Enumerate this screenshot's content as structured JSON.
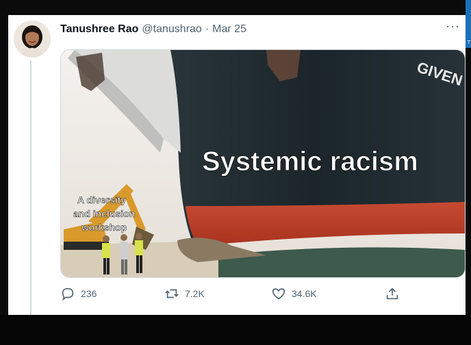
{
  "tweet": {
    "name": "Tanushree Rao",
    "handle": "@tanushrao",
    "separator": "·",
    "date": "Mar 25",
    "more": "···"
  },
  "media": {
    "caption_ship": "Systemic racism",
    "caption_excavator": "A diversity and inclusion workshop",
    "hull_lettering": "GIVEN"
  },
  "actions": {
    "replies": "236",
    "retweets": "7.2K",
    "likes": "34.6K"
  },
  "colors": {
    "hull_dark": "#1f2a2f",
    "hull_red": "#c8432c",
    "water": "#3d5a4c",
    "sand": "#d8cdb9",
    "excavator": "#d99a2b",
    "muted_text": "#536471"
  }
}
